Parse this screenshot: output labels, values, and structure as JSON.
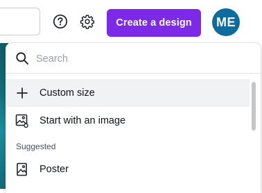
{
  "topbar": {
    "help_icon": "question-circle-icon",
    "settings_icon": "gear-icon",
    "create_button_label": "Create a design",
    "avatar_initials": "ME",
    "colors": {
      "primary": "#7d2ae8",
      "avatar": "#0d6b9e"
    }
  },
  "dropdown": {
    "search_placeholder": "Search",
    "items": [
      {
        "label": "Custom size",
        "icon": "plus-icon",
        "active": true
      },
      {
        "label": "Start with an image",
        "icon": "image-icon",
        "active": false
      }
    ],
    "section_label": "Suggested",
    "suggested": [
      {
        "label": "Poster",
        "icon": "poster-icon"
      }
    ]
  }
}
